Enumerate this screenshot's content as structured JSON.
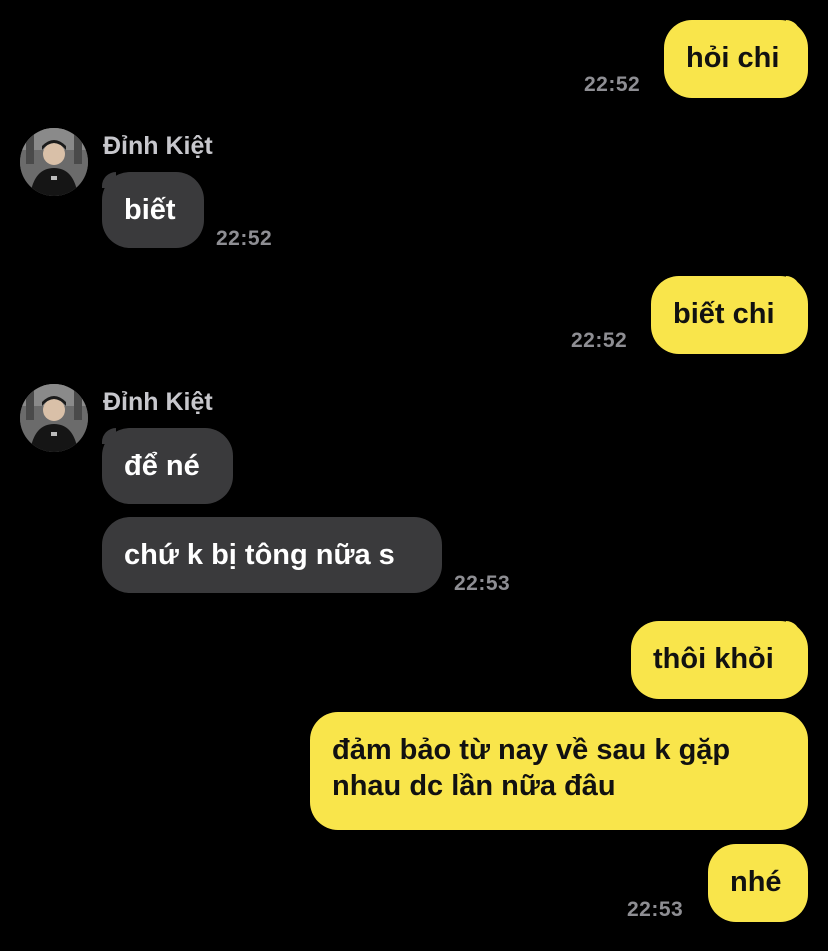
{
  "messages": [
    {
      "sender": "me",
      "text": "hỏi chi",
      "time": "22:52"
    },
    {
      "sender": "Đỉnh Kiệt",
      "text": "biết",
      "time": "22:52"
    },
    {
      "sender": "me",
      "text": "biết chi",
      "time": "22:52"
    },
    {
      "sender": "Đỉnh Kiệt",
      "text": "để né",
      "time": ""
    },
    {
      "sender": "Đỉnh Kiệt",
      "text": "chứ k bị tông nữa s",
      "time": "22:53"
    },
    {
      "sender": "me",
      "text": "thôi khỏi",
      "time": ""
    },
    {
      "sender": "me",
      "text": "đảm bảo từ nay về sau k gặp nhau dc lần nữa đâu",
      "time": ""
    },
    {
      "sender": "me",
      "text": "nhé",
      "time": "22:53"
    }
  ],
  "contact": {
    "name": "Đỉnh Kiệt",
    "avatar_icon": "person-avatar-icon"
  },
  "colors": {
    "background": "#000000",
    "outgoing_bubble": "#f9e54b",
    "incoming_bubble": "#3a3a3c",
    "timestamp": "#8e8e93"
  }
}
